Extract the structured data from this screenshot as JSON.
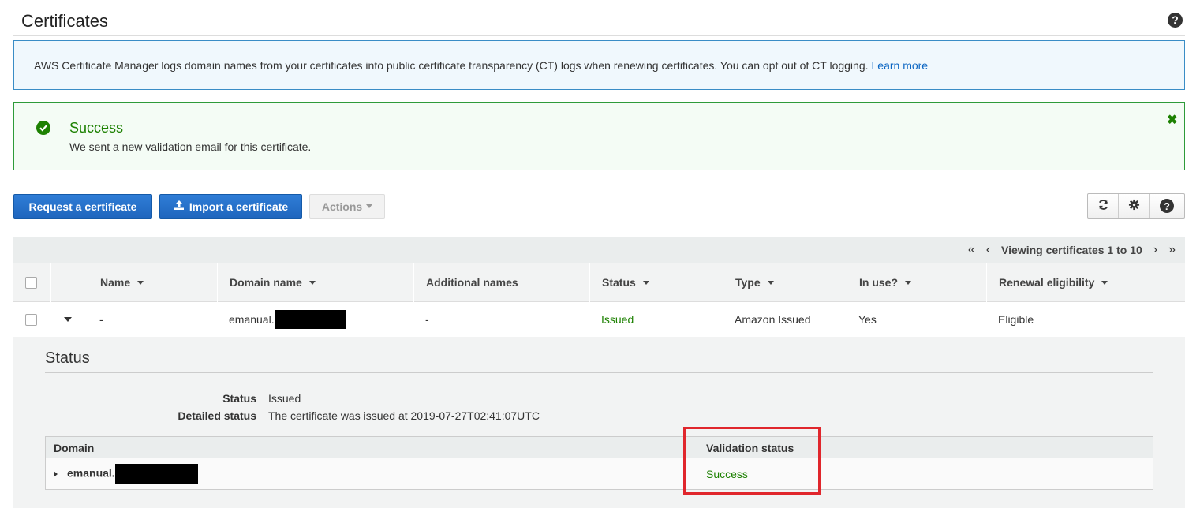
{
  "page": {
    "title": "Certificates"
  },
  "info_banner": {
    "text": "AWS Certificate Manager logs domain names from your certificates into public certificate transparency (CT) logs when renewing certificates. You can opt out of CT logging.",
    "link": "Learn more"
  },
  "alert": {
    "title": "Success",
    "message": "We sent a new validation email for this certificate.",
    "close_glyph": "✖"
  },
  "toolbar": {
    "request_label": "Request a certificate",
    "import_label": "Import a certificate",
    "actions_label": "Actions"
  },
  "pager": {
    "text": "Viewing certificates 1 to 10",
    "first": "«",
    "prev": "‹",
    "next": "›",
    "last": "»"
  },
  "table": {
    "columns": [
      "Name",
      "Domain name",
      "Additional names",
      "Status",
      "Type",
      "In use?",
      "Renewal eligibility"
    ],
    "row": {
      "name": "-",
      "domain": "emanual.",
      "additional": "-",
      "status": "Issued",
      "type": "Amazon Issued",
      "in_use": "Yes",
      "renewal": "Eligible"
    }
  },
  "detail": {
    "title": "Status",
    "status_label": "Status",
    "status_value": "Issued",
    "detailed_label": "Detailed status",
    "detailed_value": "The certificate was issued at 2019-07-27T02:41:07UTC",
    "validation_table": {
      "col_domain": "Domain",
      "col_validation": "Validation status",
      "domain": "emanual.",
      "validation": "Success"
    }
  },
  "colors": {
    "primary": "#1f66be",
    "success": "#1d8102",
    "info_border": "#3a8dc6",
    "highlight": "#e0262c"
  }
}
